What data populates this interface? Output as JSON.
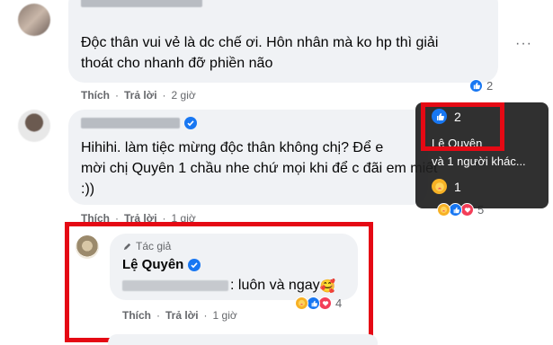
{
  "comment1": {
    "text_line1": "Độc thân vui vẻ là dc chế ơi. Hôn nhân mà ko hp thì giải",
    "text_line2": "thoát cho nhanh đỡ phiền não",
    "like": "Thích",
    "reply": "Trả lời",
    "time": "2 giờ",
    "reaction_count": "2",
    "more": "···"
  },
  "comment2": {
    "text_line1": "Hihihi. làm tiệc mừng độc thân không chị? Để e",
    "text_line2": "mời chị Quyên 1 chầu nhe chứ mọi khi để c đãi em miết",
    "text_line3": ":))",
    "like": "Thích",
    "reply": "Trả lời",
    "time": "1 giờ",
    "reaction_count": "5"
  },
  "tooltip": {
    "like_count": "2",
    "name_line1": "Lệ Quyên",
    "name_line2": "và 1 người khác...",
    "care_count": "1"
  },
  "reply": {
    "author_badge": "Tác giả",
    "author_name": "Lệ Quyên",
    "text_visible": ": luôn và ngay",
    "emoji": "🥰",
    "like": "Thích",
    "reply": "Trả lời",
    "time": "1 giờ",
    "reaction_count": "4"
  },
  "colors": {
    "accent": "#1877f2",
    "highlight": "#e50914",
    "bubble": "#f0f2f5",
    "secondary_text": "#65676b"
  }
}
